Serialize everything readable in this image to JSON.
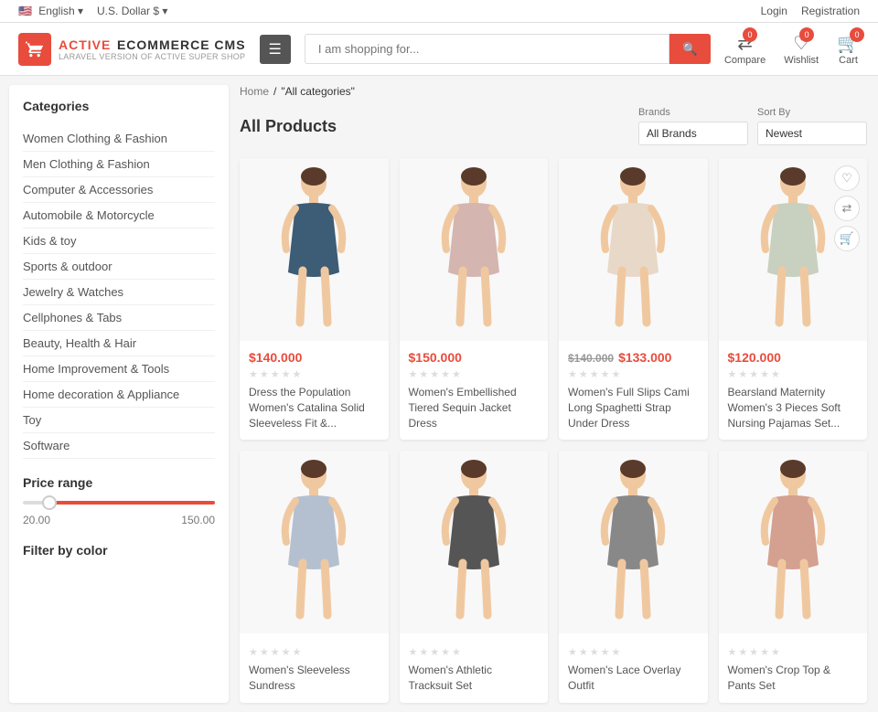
{
  "topbar": {
    "language": "English",
    "currency": "U.S. Dollar $",
    "login": "Login",
    "registration": "Registration"
  },
  "header": {
    "logo": {
      "active": "ACTIVE",
      "ecommerce": "ECOMMERCE CMS",
      "cms_sub": "LARAVEL VERSION OF ACTIVE SUPER SHOP"
    },
    "search_placeholder": "I am shopping for...",
    "compare_label": "Compare",
    "wishlist_label": "Wishlist",
    "cart_label": "Cart",
    "compare_count": "0",
    "wishlist_count": "0",
    "cart_count": "0"
  },
  "breadcrumb": {
    "home": "Home",
    "separator": "/",
    "current": "\"All categories\""
  },
  "page": {
    "title": "All Products"
  },
  "filters": {
    "brands_label": "Brands",
    "brands_default": "All Brands",
    "sort_label": "Sort By",
    "sort_default": "Newest"
  },
  "sidebar": {
    "categories_title": "Categories",
    "categories": [
      "Women Clothing & Fashion",
      "Men Clothing & Fashion",
      "Computer & Accessories",
      "Automobile & Motorcycle",
      "Kids & toy",
      "Sports & outdoor",
      "Jewelry & Watches",
      "Cellphones & Tabs",
      "Beauty, Health & Hair",
      "Home Improvement & Tools",
      "Home decoration & Appliance",
      "Toy",
      "Software"
    ],
    "price_range_title": "Price range",
    "price_min": "20.00",
    "price_max": "150.00",
    "filter_color_title": "Filter by color"
  },
  "products": [
    {
      "id": 1,
      "price": "$140.000",
      "old_price": null,
      "name": "Dress the Population Women's Catalina Solid Sleeveless Fit &...",
      "color": "#3d5c75"
    },
    {
      "id": 2,
      "price": "$150.000",
      "old_price": null,
      "name": "Women's Embellished Tiered Sequin Jacket Dress",
      "color": "#d4b5b0"
    },
    {
      "id": 3,
      "price": "$133.000",
      "old_price": "$140.000",
      "name": "Women's Full Slips Cami Long Spaghetti Strap Under Dress",
      "color": "#e8e0d5"
    },
    {
      "id": 4,
      "price": "$120.000",
      "old_price": null,
      "name": "Bearsland Maternity Women's 3 Pieces Soft Nursing Pajamas Set...",
      "color": "#c8d5c0"
    },
    {
      "id": 5,
      "price": null,
      "old_price": null,
      "name": "Women's Sleeveless Sundress",
      "color": "#b8c4d4"
    },
    {
      "id": 6,
      "price": null,
      "old_price": null,
      "name": "Women's Athletic Tracksuit Set",
      "color": "#555"
    },
    {
      "id": 7,
      "price": null,
      "old_price": null,
      "name": "Women's Lace Overlay Outfit",
      "color": "#888"
    },
    {
      "id": 8,
      "price": null,
      "old_price": null,
      "name": "Women's Crop Top & Pants Set",
      "color": "#d4a0a0"
    }
  ]
}
